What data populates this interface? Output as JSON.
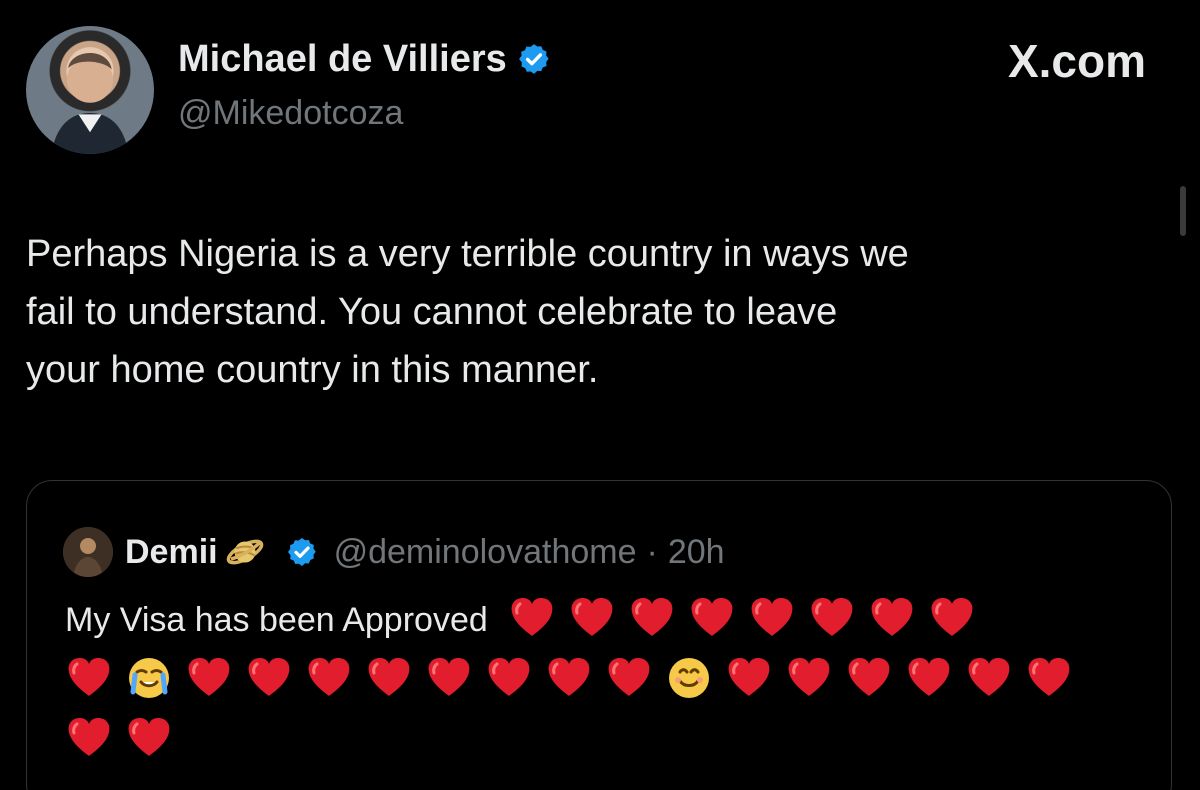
{
  "author": {
    "name": "Michael de Villiers",
    "handle": "@Mikedotcoza",
    "verified_icon": "verified-badge"
  },
  "brand": {
    "label": "X.com"
  },
  "tweet": {
    "text": "Perhaps Nigeria is a very terrible country in ways we\nfail to understand. You cannot celebrate to leave\nyour home country in this manner."
  },
  "quote": {
    "name": "Demii",
    "handle": "@deminolovathome",
    "separator": "·",
    "time": "20h",
    "text": "My Visa has been Approved",
    "emojis_line1": [
      "heart",
      "heart",
      "heart",
      "heart",
      "heart",
      "heart",
      "heart",
      "heart"
    ],
    "emojis_line2": [
      "heart",
      "sob",
      "heart",
      "heart",
      "heart",
      "heart",
      "heart",
      "heart",
      "heart",
      "heart",
      "smile",
      "heart",
      "heart",
      "heart",
      "heart",
      "heart",
      "heart"
    ],
    "emojis_line3": [
      "heart",
      "heart"
    ]
  },
  "colors": {
    "background": "#000000",
    "text": "#e7e9ea",
    "muted": "#71767b",
    "verified": "#1d9bf0",
    "heart": "#e11d2e"
  }
}
